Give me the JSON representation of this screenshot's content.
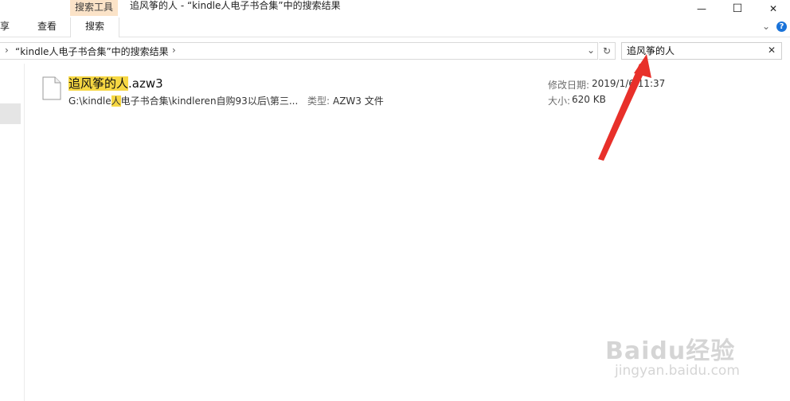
{
  "window": {
    "title": "追风筝的人 - “kindle人电子书合集”中的搜索结果",
    "context_tab_group": "搜索工具",
    "minimize_symbol": "—",
    "maximize_symbol": "☐",
    "close_symbol": "✕"
  },
  "ribbon": {
    "tabs": [
      "共享",
      "查看",
      "搜索"
    ],
    "active_tab": "搜索",
    "expand_symbol": "⌄",
    "help_symbol": "?"
  },
  "address": {
    "lead_chevron": "›",
    "location": "“kindle人电子书合集”中的搜索结果",
    "chevron": "›",
    "dropdown_symbol": "⌄",
    "refresh_symbol": "↻"
  },
  "search": {
    "value": "追风筝的人",
    "clear_symbol": "✕"
  },
  "results": [
    {
      "name_highlight": "追风筝的人",
      "name_rest": ".azw3",
      "path_before": "G:\\kindle",
      "path_highlight": "人",
      "path_after": "电子书合集\\kindleren自购93以后\\第三...",
      "type_label": "类型:",
      "type_value": "AZW3 文件",
      "date_label": "修改日期:",
      "date_value": "2019/1/6 11:37",
      "size_label": "大小:",
      "size_value": "620 KB"
    }
  ],
  "watermark": {
    "main": "Baidu经验",
    "sub": "jingyan.baidu.com"
  },
  "colors": {
    "highlight": "#f6d743",
    "context_tab": "#fbe3c8",
    "annotation_arrow": "#e8302a"
  }
}
